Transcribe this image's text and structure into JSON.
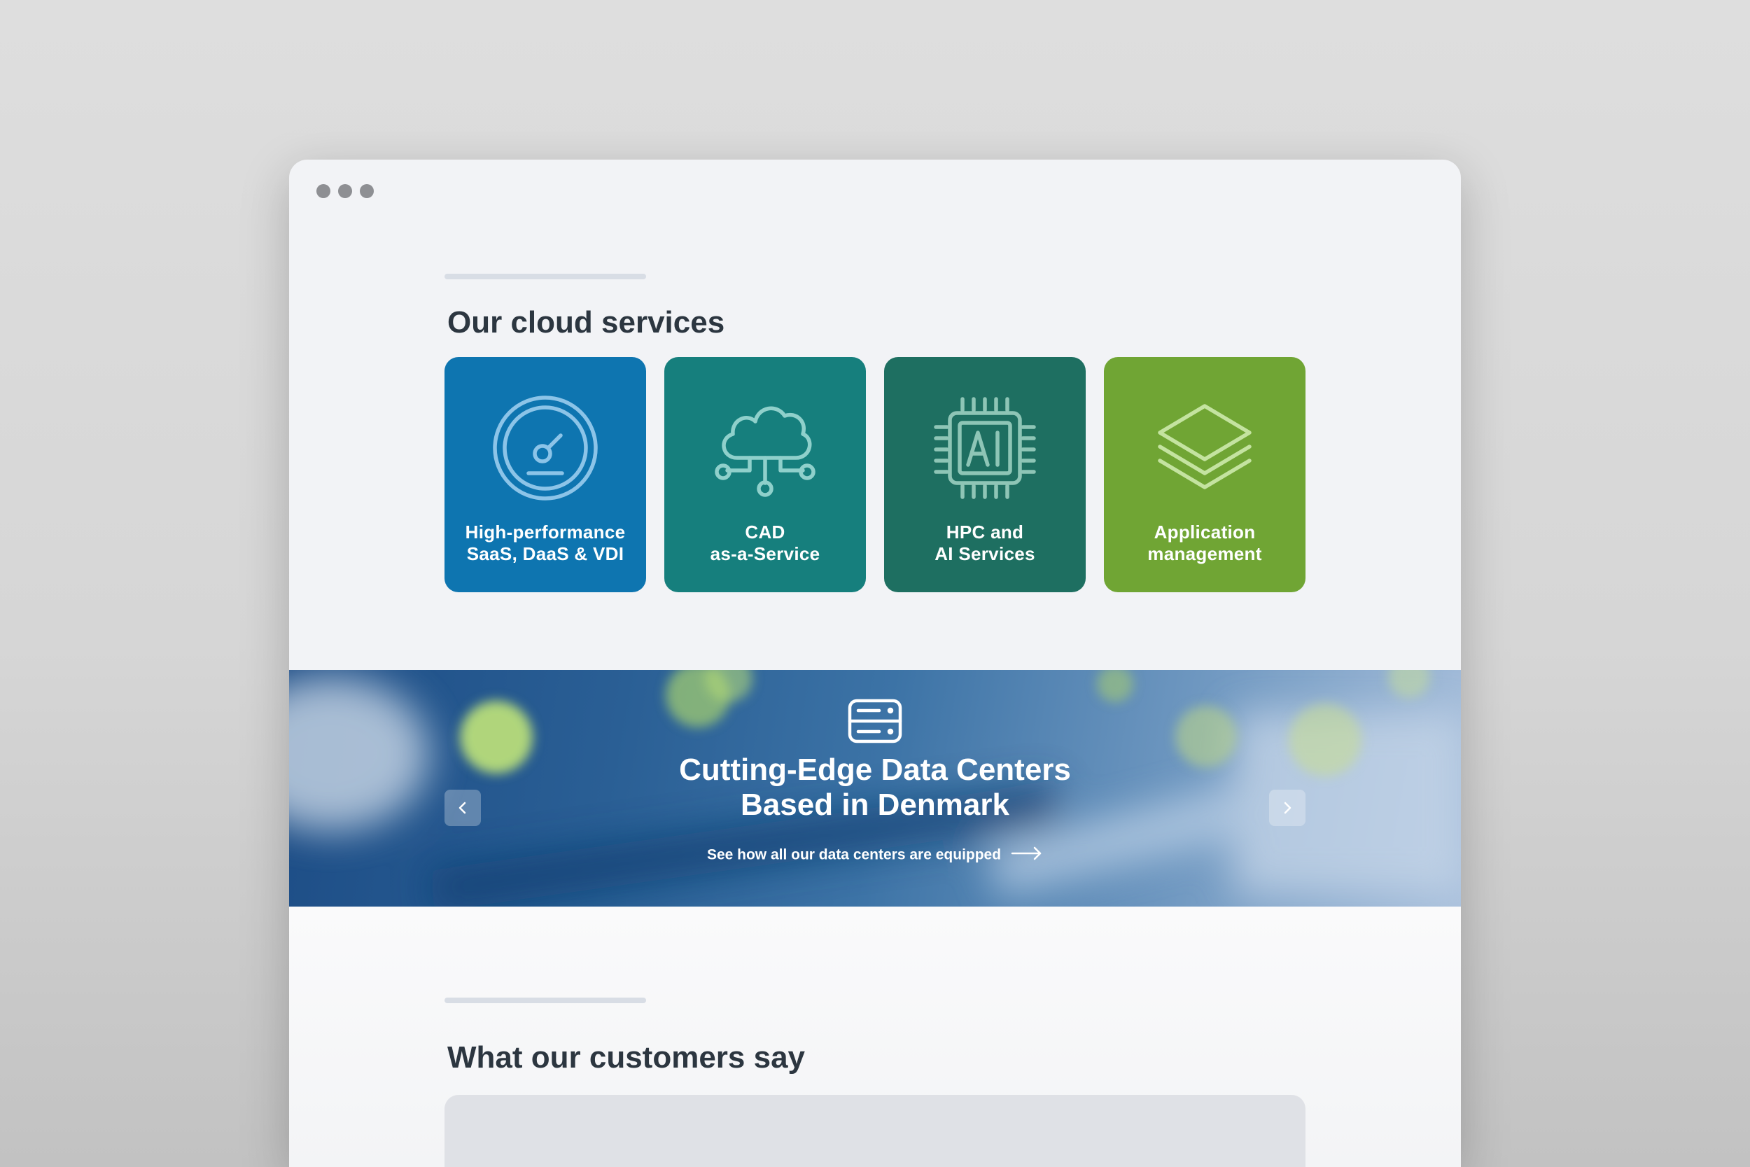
{
  "window": {
    "controls": [
      "dot",
      "dot",
      "dot"
    ]
  },
  "services": {
    "heading": "Our cloud services",
    "cards": [
      {
        "label_line1": "High-performance",
        "label_line2": "SaaS, DaaS & VDI",
        "icon": "speedometer-icon",
        "color": "#0e75b0"
      },
      {
        "label_line1": "CAD",
        "label_line2": "as-a-Service",
        "icon": "cloud-network-icon",
        "color": "#167f7d"
      },
      {
        "label_line1": "HPC and",
        "label_line2": "AI Services",
        "icon": "ai-chip-icon",
        "color": "#1e6f61"
      },
      {
        "label_line1": "Application",
        "label_line2": "management",
        "icon": "layers-icon",
        "color": "#70a534"
      }
    ]
  },
  "banner": {
    "icon": "server-icon",
    "title_line1": "Cutting-Edge Data Centers",
    "title_line2": "Based in Denmark",
    "link_text": "See how all our data centers are equipped",
    "prev_icon": "chevron-left-icon",
    "next_icon": "chevron-right-icon"
  },
  "testimonials": {
    "heading": "What our customers say"
  }
}
